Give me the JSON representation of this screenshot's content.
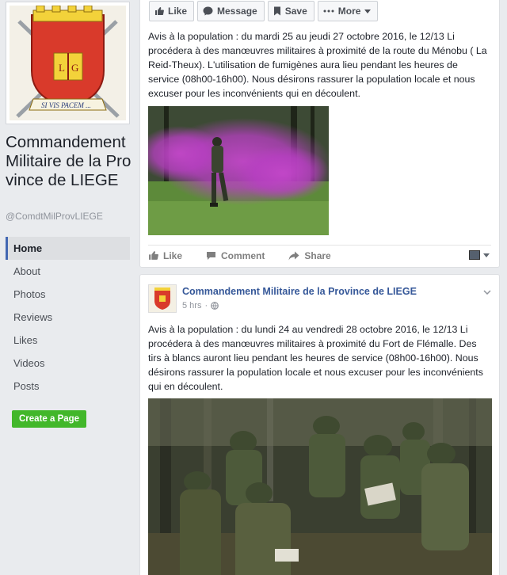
{
  "page": {
    "name": "Commandement Militaire de la Province de LIEGE",
    "handle": "@ComdtMilProvLIEGE",
    "crest_motto": "SI VIS PACEM ..."
  },
  "nav": {
    "items": [
      {
        "label": "Home",
        "active": true
      },
      {
        "label": "About"
      },
      {
        "label": "Photos"
      },
      {
        "label": "Reviews"
      },
      {
        "label": "Likes"
      },
      {
        "label": "Videos"
      },
      {
        "label": "Posts"
      }
    ],
    "create_page": "Create a Page"
  },
  "page_actions": {
    "like": "Like",
    "message": "Message",
    "save": "Save",
    "more": "More"
  },
  "posts": [
    {
      "text": "Avis à la population : du mardi 25 au jeudi 27 octobre 2016, le 12/13 Li procédera à des manœuvres militaires à proximité de la route du Ménobu ( La Reid-Theux). L'utilisation de fumigènes aura lieu pendant les heures de service (08h00-16h00). Nous désirons rassurer la population locale et nous excuser pour les inconvénients qui en découlent.",
      "actions": {
        "like": "Like",
        "comment": "Comment",
        "share": "Share"
      }
    },
    {
      "author": "Commandement Militaire de la Province de LIEGE",
      "time": "5 hrs",
      "text": "Avis à la population : du lundi 24 au vendredi 28 octobre 2016, le 12/13 Li procédera à des manœuvres militaires à proximité du Fort de Flémalle. Des tirs à blancs auront lieu pendant les heures de service (08h00-16h00). Nous désirons rassurer la population locale et nous excuser pour les inconvénients qui en découlent."
    }
  ],
  "colors": {
    "link": "#365899",
    "accent": "#4267b2",
    "create_button": "#42b72a",
    "crest_red": "#d93a2b",
    "crest_gold": "#f3d23a"
  },
  "icons": [
    "thumbs-up-icon",
    "message-icon",
    "bookmark-icon",
    "dots-icon",
    "caret-down-icon",
    "comment-icon",
    "share-icon",
    "globe-icon",
    "chevron-down-icon"
  ]
}
